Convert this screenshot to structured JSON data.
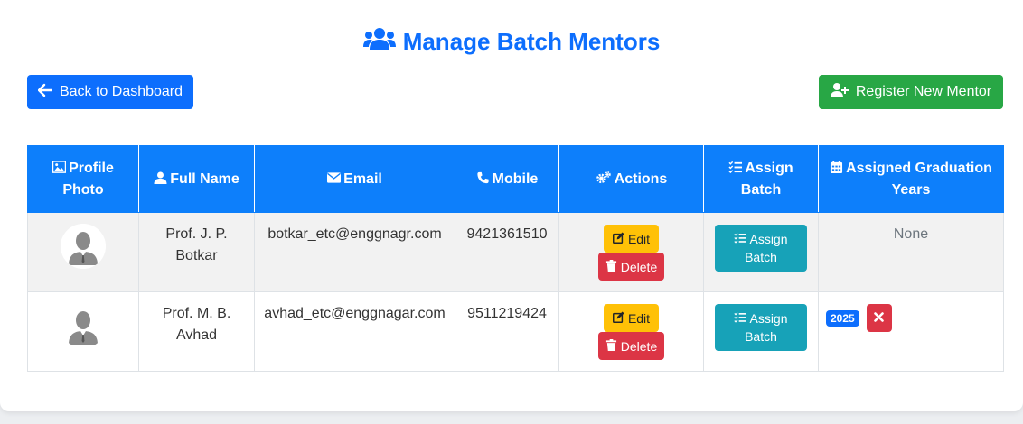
{
  "page": {
    "title": "Manage Batch Mentors",
    "back_label": "Back to Dashboard",
    "register_label": "Register New Mentor"
  },
  "table": {
    "headers": {
      "photo": "Profile Photo",
      "name": "Full Name",
      "email": "Email",
      "mobile": "Mobile",
      "actions": "Actions",
      "assign": "Assign Batch",
      "years": "Assigned Graduation Years"
    },
    "edit_label": "Edit",
    "delete_label": "Delete",
    "assign_label_1": "Assign",
    "assign_label_2": "Batch",
    "rows": [
      {
        "name_line1": "Prof. J. P.",
        "name_line2": "Botkar",
        "email": "botkar_etc@enggnagr.com",
        "mobile": "9421361510",
        "years_text": "None"
      },
      {
        "name_line1": "Prof. M. B.",
        "name_line2": "Avhad",
        "email": "avhad_etc@enggnagar.com",
        "mobile": "9511219424",
        "year_badge": "2025"
      }
    ]
  },
  "colors": {
    "primary": "#0d6efd",
    "success": "#28a745",
    "warning": "#ffc107",
    "danger": "#dc3545",
    "info": "#17a2b8",
    "header_bg": "#0d7ffb"
  }
}
